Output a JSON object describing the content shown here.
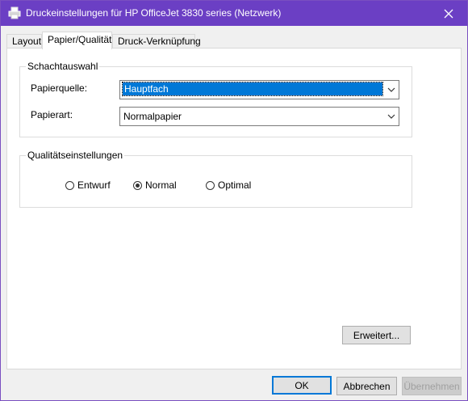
{
  "window": {
    "title": "Druckeinstellungen für HP OfficeJet 3830 series (Netzwerk)",
    "accent_color": "#6b3fc4"
  },
  "tabs": [
    {
      "label": "Layout",
      "active": false
    },
    {
      "label": "Papier/Qualität",
      "active": true
    },
    {
      "label": "Druck-Verknüpfung",
      "active": false
    }
  ],
  "tray_group": {
    "legend": "Schachtauswahl",
    "paper_source_label": "Papierquelle:",
    "paper_source_value": "Hauptfach",
    "paper_type_label": "Papierart:",
    "paper_type_value": "Normalpapier"
  },
  "quality_group": {
    "legend": "Qualitätseinstellungen",
    "options": [
      {
        "label": "Entwurf",
        "selected": false
      },
      {
        "label": "Normal",
        "selected": true
      },
      {
        "label": "Optimal",
        "selected": false
      }
    ]
  },
  "buttons": {
    "advanced": "Erweitert...",
    "ok": "OK",
    "cancel": "Abbrechen",
    "apply": "Übernehmen"
  },
  "icons": {
    "app": "printer-icon",
    "close": "close-icon",
    "dropdown": "chevron-down-icon"
  }
}
